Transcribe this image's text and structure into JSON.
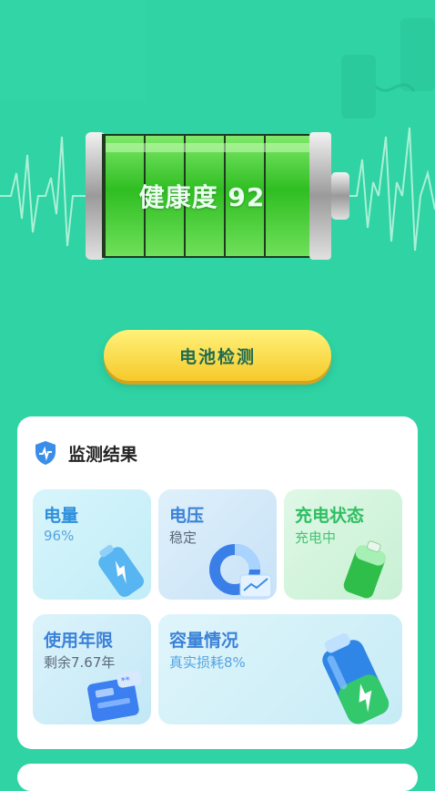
{
  "hero": {
    "health_label": "健康度 92",
    "health_value": 92
  },
  "actions": {
    "check_button": "电池检测"
  },
  "results": {
    "title": "监测结果",
    "tiles": [
      {
        "title": "电量",
        "value": "96%"
      },
      {
        "title": "电压",
        "value": "稳定"
      },
      {
        "title": "充电状态",
        "value": "充电中"
      },
      {
        "title": "使用年限",
        "value": "剩余7.67年"
      },
      {
        "title": "容量情况",
        "value": "真实损耗8%"
      }
    ]
  },
  "colors": {
    "background": "#2fd3a4",
    "button": "#f6c92b",
    "battery_green": "#3fcf2c"
  },
  "icons": [
    "shield-pulse-icon",
    "battery-charge-icon",
    "donut-chart-icon",
    "green-battery-icon",
    "calendar-card-icon",
    "big-battery-icon"
  ]
}
